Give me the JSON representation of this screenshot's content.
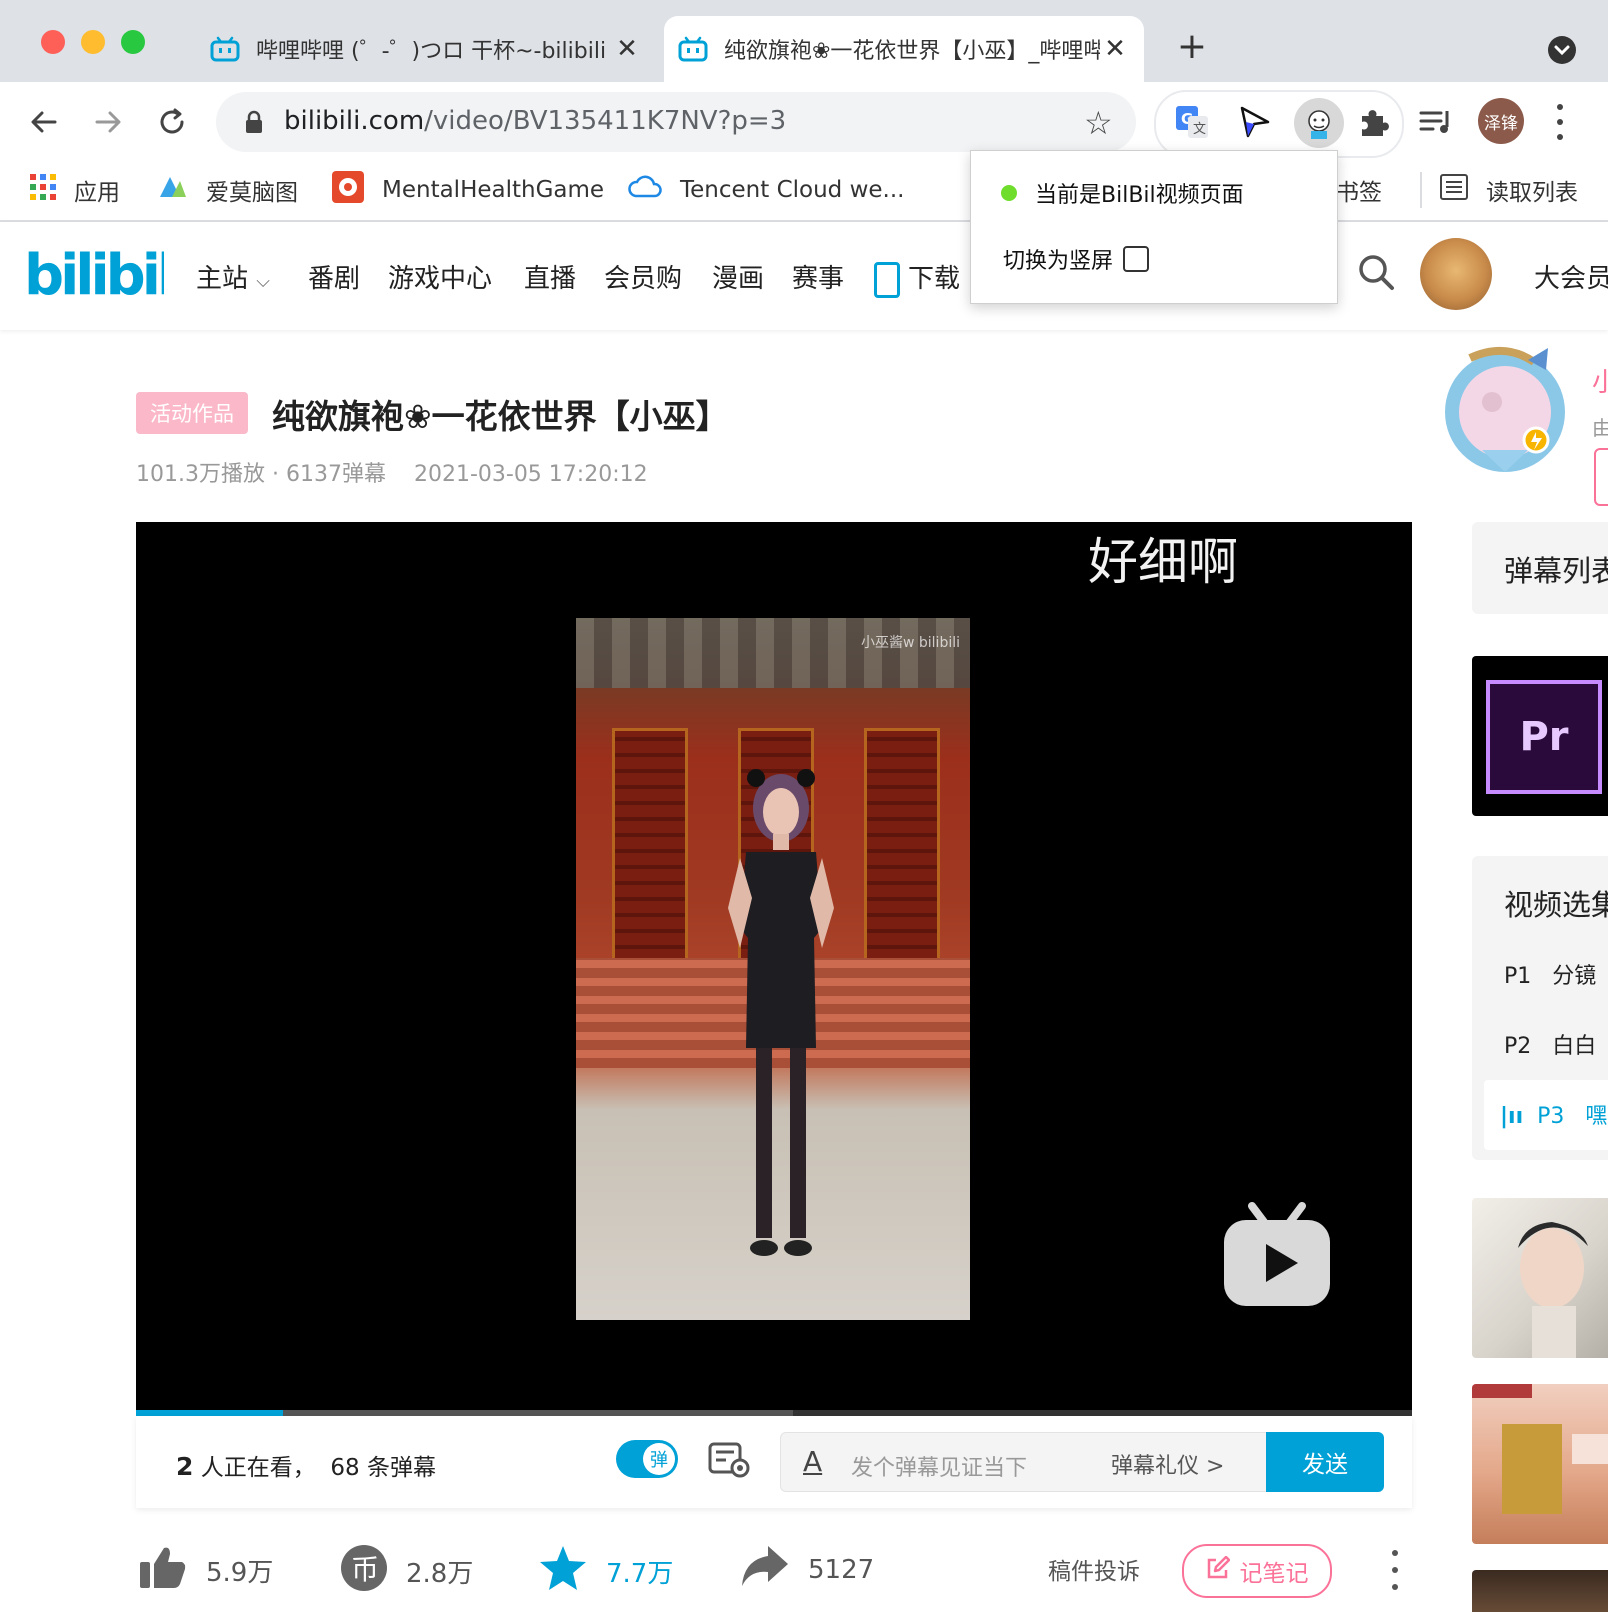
{
  "browser": {
    "tabs": [
      {
        "title": "哔哩哔哩 (゜-゜)つロ 干杯~-bilibili",
        "active": false
      },
      {
        "title": "纯欲旗袍❀一花依世界【小巫】_哔哩哔哩",
        "active": true
      }
    ],
    "url_host": "bilibili.com",
    "url_path": "/video/BV135411K7NV?p=3",
    "profile_name": "泽锋",
    "bookmarks": [
      "应用",
      "爱莫脑图",
      "MentalHealthGame",
      "Tencent Cloud we...",
      "书签",
      "读取列表"
    ]
  },
  "popup": {
    "status": "当前是BilBil视频页面",
    "switch_label": "切换为竖屏"
  },
  "site": {
    "nav": [
      "主站",
      "番剧",
      "游戏中心",
      "直播",
      "会员购",
      "漫画",
      "赛事",
      "下载"
    ],
    "big_member": "大会员"
  },
  "video": {
    "tag": "活动作品",
    "title": "纯欲旗袍❀一花依世界【小巫】",
    "plays": "101.3万播放",
    "danmaku_count": "6137弹幕",
    "date": "2021-03-05 17:20:12",
    "danmaku_overlay": "好细啊",
    "watermark": "小巫酱w bilibili",
    "progress": 0.115,
    "buffered": 0.515
  },
  "danmaku_bar": {
    "viewers": "2",
    "viewers_text": "人正在看，",
    "dm_num": "68",
    "dm_text": "条弹幕",
    "toggle_label": "弹",
    "input_icon": "A",
    "placeholder": "发个弹幕见证当下",
    "etiquette": "弹幕礼仪 >",
    "send": "发送"
  },
  "actions": {
    "like": "5.9万",
    "coin": "2.8万",
    "favorite": "7.7万",
    "share": "5127",
    "report": "稿件投诉",
    "notes": "记笔记"
  },
  "sidebar": {
    "up_name_partial": "小",
    "up_sub_partial": "由",
    "danmaku_list": "弹幕列表",
    "ad_text": "Pr",
    "episodes_title": "视频选集",
    "episodes": [
      {
        "num": "P1",
        "title": "分镜"
      },
      {
        "num": "P2",
        "title": "白白"
      },
      {
        "num": "P3",
        "title": "嘿"
      }
    ]
  },
  "colors": {
    "bili_blue": "#00a1d6",
    "bili_pink": "#fb7299",
    "tag_pink": "#fbb8c8"
  }
}
